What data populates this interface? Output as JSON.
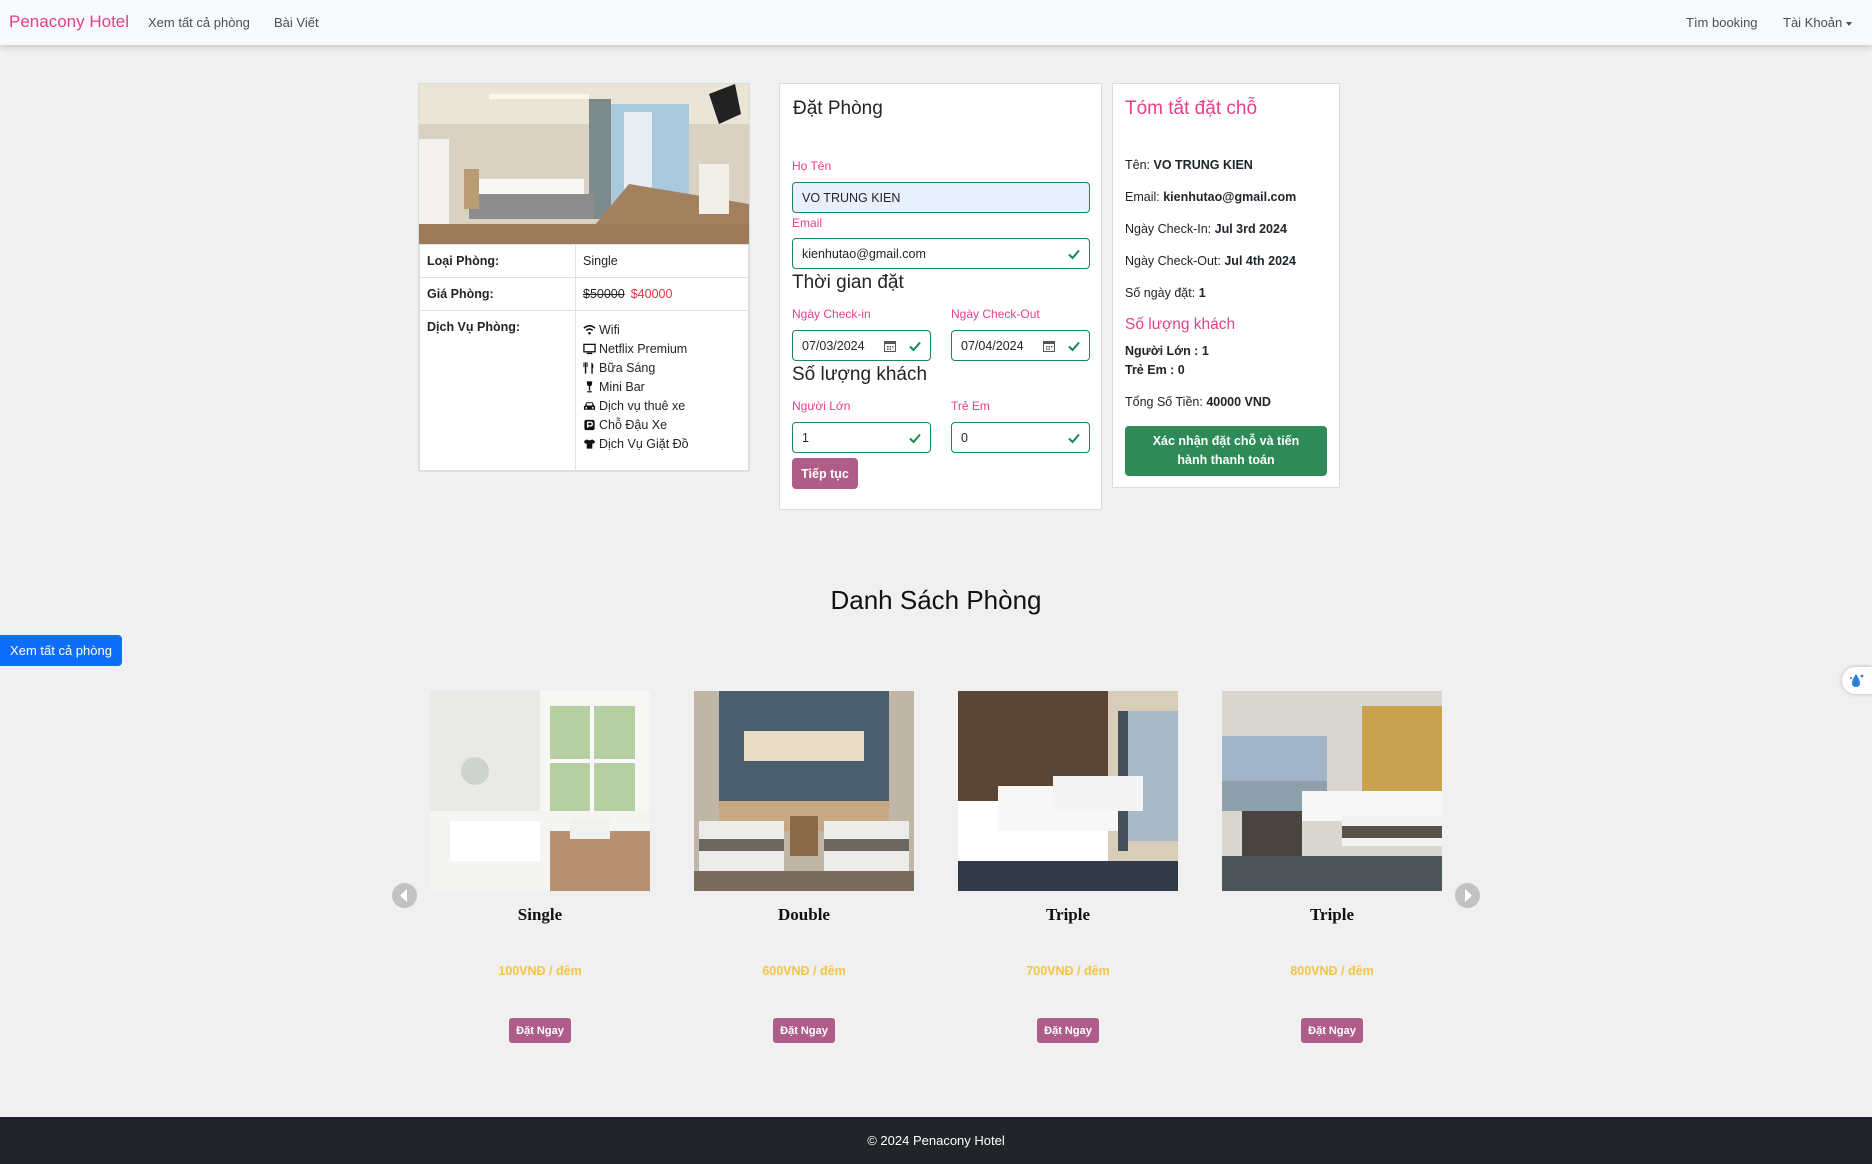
{
  "navbar": {
    "brand": "Penacony Hotel",
    "links": [
      "Xem tất cả phòng",
      "Bài Viết"
    ],
    "right_links": [
      "Tìm booking",
      "Tài Khoản"
    ]
  },
  "room_info": {
    "type_label": "Loại Phòng:",
    "type_value": "Single",
    "price_label": "Giá Phòng:",
    "old_price": "$50000",
    "new_price": "$40000",
    "services_label": "Dịch Vụ Phòng:",
    "services": [
      {
        "icon": "wifi-icon",
        "label": "Wifi"
      },
      {
        "icon": "tv-icon",
        "label": "Netflix Premium"
      },
      {
        "icon": "utensils-icon",
        "label": "Bữa Sáng"
      },
      {
        "icon": "wine-glass-icon",
        "label": "Mini Bar"
      },
      {
        "icon": "car-icon",
        "label": "Dịch vụ thuê xe"
      },
      {
        "icon": "parking-icon",
        "label": "Chỗ Đậu Xe"
      },
      {
        "icon": "shirt-icon",
        "label": "Dịch Vụ Giặt Đồ"
      }
    ]
  },
  "booking_form": {
    "title": "Đặt Phòng",
    "name_label": "Họ Tên",
    "name_value": "VO TRUNG KIEN",
    "email_label": "Email",
    "email_value": "kienhutao@gmail.com",
    "time_section": "Thời gian đặt",
    "checkin_label": "Ngày Check-in",
    "checkin_value": "07/03/2024",
    "checkout_label": "Ngày Check-Out",
    "checkout_value": "07/04/2024",
    "guests_section": "Số lượng khách",
    "adults_label": "Người Lớn",
    "adults_value": "1",
    "children_label": "Trẻ Em",
    "children_value": "0",
    "continue_button": "Tiếp tục"
  },
  "summary": {
    "title": "Tóm tắt đặt chỗ",
    "name_label": "Tên:",
    "name_value": "VO TRUNG KIEN",
    "email_label": "Email:",
    "email_value": "kienhutao@gmail.com",
    "checkin_label": "Ngày Check-In:",
    "checkin_value": "Jul 3rd 2024",
    "checkout_label": "Ngày Check-Out:",
    "checkout_value": "Jul 4th 2024",
    "days_label": "Số ngày đặt:",
    "days_value": "1",
    "guests_title": "Số lượng khách",
    "adults_text": "Người Lớn : 1",
    "children_text": "Trẻ Em : 0",
    "total_label": "Tổng Số Tiền:",
    "total_value": "40000 VND",
    "confirm_button": "Xác nhận đặt chỗ và tiến hành thanh toán"
  },
  "room_list": {
    "title": "Danh Sách Phòng",
    "view_all_button": "Xem tất cả phòng",
    "rooms": [
      {
        "name": "Single",
        "price": "100VNĐ / đêm",
        "button": "Đặt Ngay"
      },
      {
        "name": "Double",
        "price": "600VNĐ / đêm",
        "button": "Đặt Ngay"
      },
      {
        "name": "Triple",
        "price": "700VNĐ / đêm",
        "button": "Đặt Ngay"
      },
      {
        "name": "Triple",
        "price": "800VNĐ / đêm",
        "button": "Đặt Ngay"
      }
    ]
  },
  "footer": {
    "text": "© 2024 Penacony Hotel"
  },
  "colors": {
    "brand": "#e83e8c",
    "accent_button": "#b05c88",
    "confirm_button": "#2e8b57",
    "primary_button": "#0d6efd",
    "price": "#f4c542",
    "footer_bg": "#212529"
  }
}
